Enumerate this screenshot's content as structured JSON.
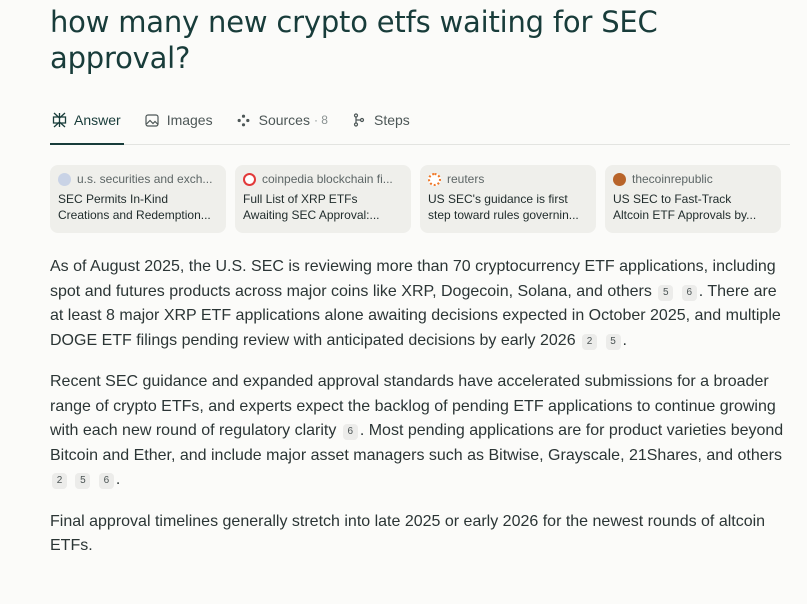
{
  "query": {
    "line1": "how many new crypto etfs waiting for SEC",
    "line2": "approval?"
  },
  "tabs": [
    {
      "label": "Answer",
      "icon": "perplexity-logo-icon"
    },
    {
      "label": "Images",
      "icon": "image-icon"
    },
    {
      "label": "Sources",
      "count": "· 8",
      "icon": "sources-icon"
    },
    {
      "label": "Steps",
      "icon": "steps-icon"
    }
  ],
  "sources": [
    {
      "site": "u.s. securities and exch...",
      "title1": "SEC Permits In-Kind",
      "title2": "Creations and Redemption...",
      "favicon_color": "#c9d3e6"
    },
    {
      "site": "coinpedia blockchain fi...",
      "title1": "Full List of XRP ETFs",
      "title2": "Awaiting SEC Approval:...",
      "favicon_color": "#e23a3a"
    },
    {
      "site": "reuters",
      "title1": "US SEC's guidance is first",
      "title2": "step toward rules governin...",
      "favicon_color": "#f07a2a"
    },
    {
      "site": "thecoinrepublic",
      "title1": "US SEC to Fast-Track",
      "title2": "Altcoin ETF Approvals by...",
      "favicon_color": "#b8642a"
    }
  ],
  "answer": {
    "p1": {
      "a": "As of August 2025, the U.S. SEC is reviewing more than 70 cryptocurrency ETF applications, including spot and futures products across major coins like XRP, Dogecoin, Solana, and others",
      "c1": "5",
      "c2": "6",
      "b": ". There are at least 8 major XRP ETF applications alone awaiting decisions expected in October 2025, and multiple DOGE ETF filings pending review with anticipated decisions by early 2026",
      "c3": "2",
      "c4": "5",
      "c": "."
    },
    "p2": {
      "a": "Recent SEC guidance and expanded approval standards have accelerated submissions for a broader range of crypto ETFs, and experts expect the backlog of pending ETF applications to continue growing with each new round of regulatory clarity",
      "c1": "6",
      "b": ". Most pending applications are for product varieties beyond Bitcoin and Ether, and include major asset managers such as Bitwise, Grayscale, 21Shares, and others",
      "c2": "2",
      "c3": "5",
      "c4": "6",
      "c": "."
    },
    "p3": "Final approval timelines generally stretch into late 2025 or early 2026 for the newest rounds of altcoin ETFs."
  }
}
